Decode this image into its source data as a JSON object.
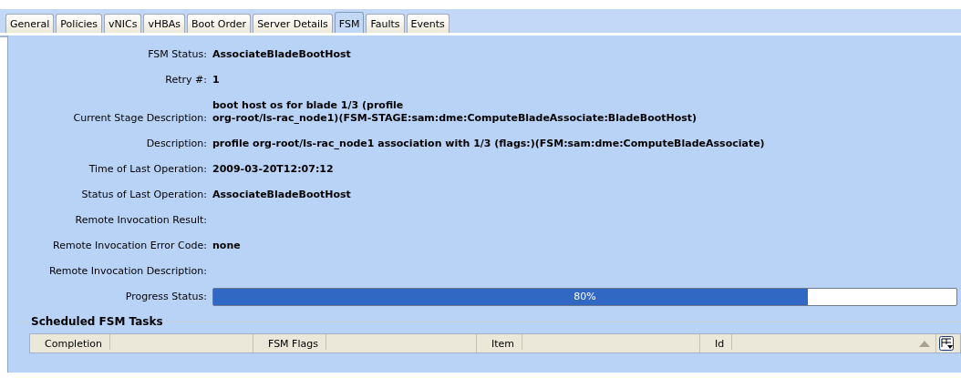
{
  "tabs": [
    {
      "label": "General",
      "selected": false
    },
    {
      "label": "Policies",
      "selected": false
    },
    {
      "label": "vNICs",
      "selected": false
    },
    {
      "label": "vHBAs",
      "selected": false
    },
    {
      "label": "Boot Order",
      "selected": false
    },
    {
      "label": "Server Details",
      "selected": false
    },
    {
      "label": "FSM",
      "selected": true
    },
    {
      "label": "Faults",
      "selected": false
    },
    {
      "label": "Events",
      "selected": false
    }
  ],
  "fields": [
    {
      "label": "FSM Status:",
      "value": "AssociateBladeBootHost"
    },
    {
      "label": "Retry #:",
      "value": "1"
    },
    {
      "label": "Current Stage Description:",
      "value": "boot host os for blade 1/3 (profile\norg-root/ls-rac_node1)(FSM-STAGE:sam:dme:ComputeBladeAssociate:BladeBootHost)"
    },
    {
      "label": "Description:",
      "value": "profile org-root/ls-rac_node1 association with 1/3 (flags:)(FSM:sam:dme:ComputeBladeAssociate)"
    },
    {
      "label": "Time of Last Operation:",
      "value": "2009-03-20T12:07:12"
    },
    {
      "label": "Status of Last Operation:",
      "value": "AssociateBladeBootHost"
    },
    {
      "label": "Remote Invocation Result:"
    },
    {
      "label": "Remote Invocation Error Code:",
      "value": "none"
    },
    {
      "label": "Remote Invocation Description:"
    }
  ],
  "progress": {
    "label": "Progress Status:",
    "level": 0.8,
    "reading": "80%"
  },
  "scheduled_tasks": {
    "title": "Scheduled FSM Tasks",
    "columns": [
      "Completion",
      "FSM Flags",
      "Item",
      "Id"
    ]
  }
}
